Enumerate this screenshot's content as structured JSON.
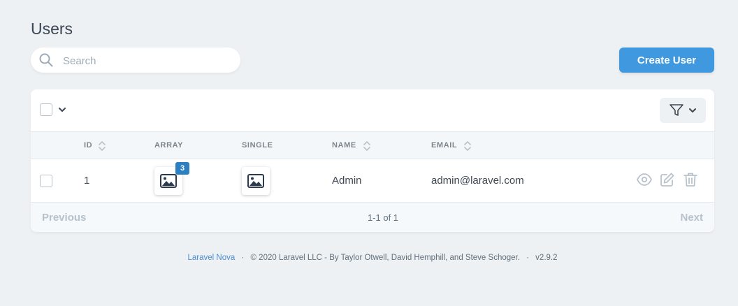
{
  "page": {
    "title": "Users"
  },
  "search": {
    "placeholder": "Search",
    "value": ""
  },
  "actions": {
    "create_label": "Create User"
  },
  "table": {
    "columns": [
      {
        "label": "ID",
        "sortable": true
      },
      {
        "label": "ARRAY",
        "sortable": false
      },
      {
        "label": "SINGLE",
        "sortable": false
      },
      {
        "label": "NAME",
        "sortable": true
      },
      {
        "label": "EMAIL",
        "sortable": true
      }
    ],
    "rows": [
      {
        "id": "1",
        "array_count": "3",
        "name": "Admin",
        "email": "admin@laravel.com"
      }
    ],
    "row_actions": [
      "view-icon",
      "edit-icon",
      "delete-icon"
    ]
  },
  "pagination": {
    "previous": "Previous",
    "info": "1-1 of 1",
    "next": "Next"
  },
  "footer": {
    "brand": "Laravel Nova",
    "copyright": "© 2020 Laravel LLC - By Taylor Otwell, David Hemphill, and Steve Schoger.",
    "version": "v2.9.2"
  },
  "colors": {
    "accent": "#4099de",
    "badge": "#2c7fc1",
    "background": "#eef1f4",
    "link": "#4c8dd0"
  }
}
